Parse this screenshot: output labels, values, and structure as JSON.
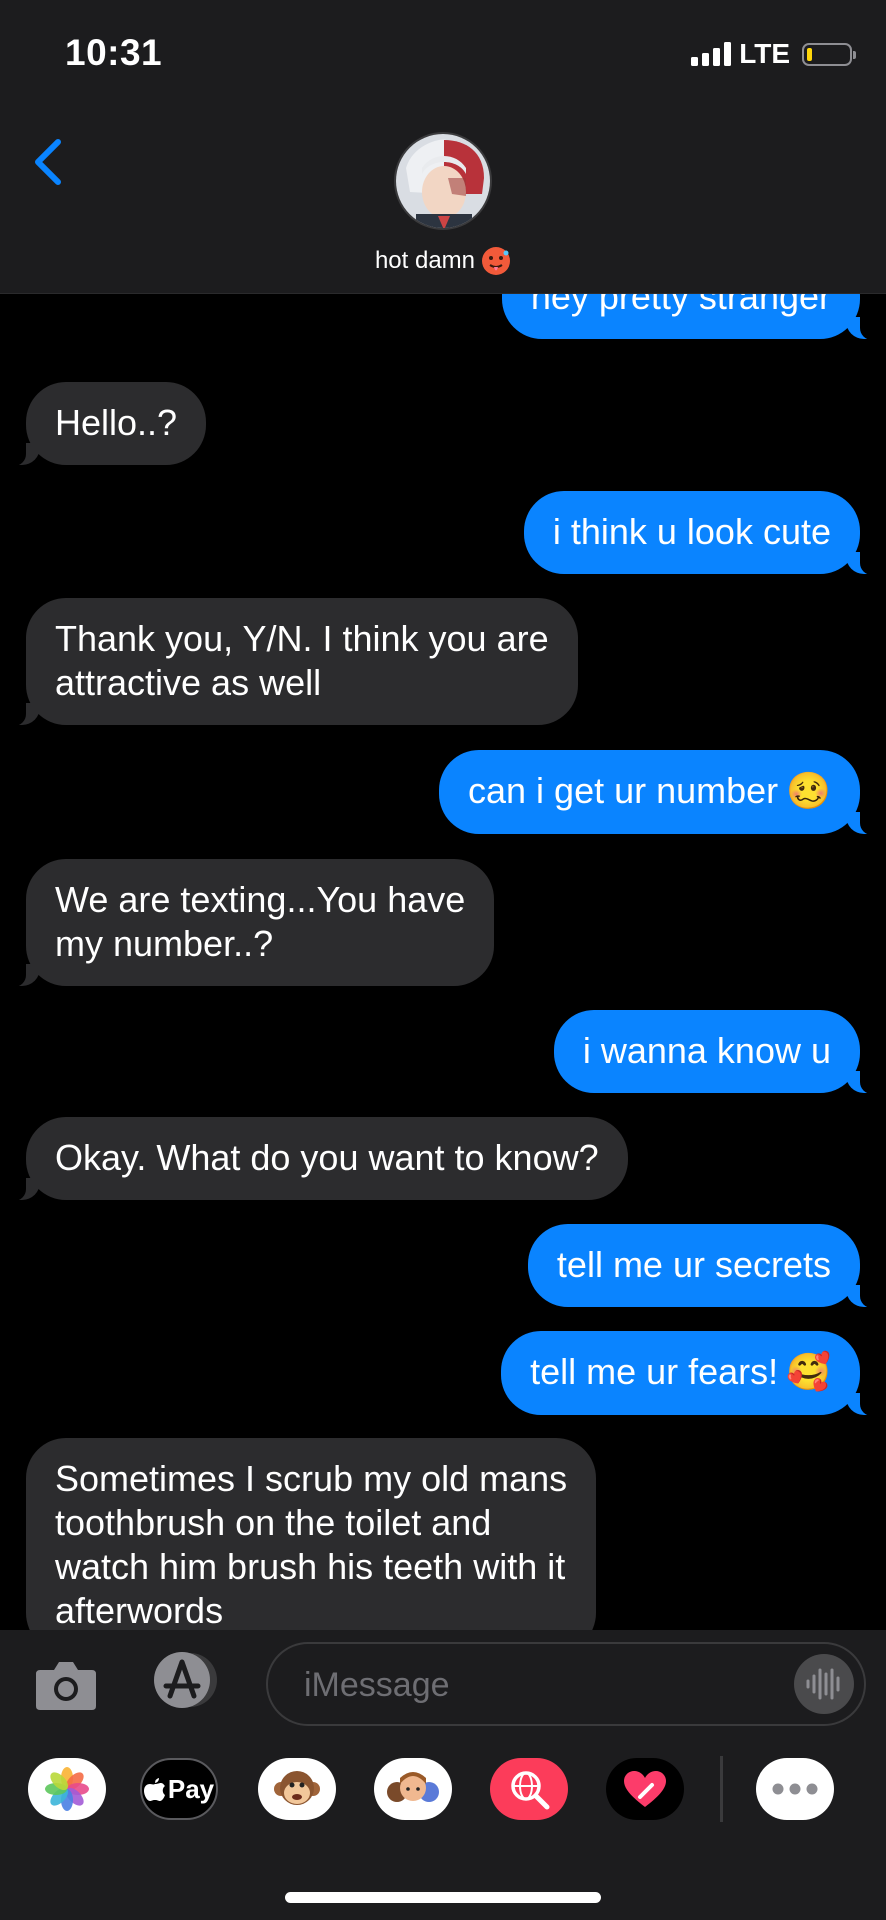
{
  "status_bar": {
    "time": "10:31",
    "network": "LTE",
    "battery_level": 0.12
  },
  "header": {
    "contact_name": "hot damn",
    "contact_emoji": "🥵",
    "back_icon": "chevron-left-icon",
    "accent_color": "#0a84ff"
  },
  "messages": [
    {
      "from": "me",
      "lines": [
        "hey pretty stranger"
      ]
    },
    {
      "from": "them",
      "lines": [
        "Hello..?"
      ]
    },
    {
      "from": "me",
      "lines": [
        "i think u look cute"
      ]
    },
    {
      "from": "them",
      "lines": [
        "Thank you, Y/N. I think you are",
        "attractive as well"
      ]
    },
    {
      "from": "me",
      "lines": [
        "can i get ur number"
      ],
      "emoji": "🥴"
    },
    {
      "from": "them",
      "lines": [
        "We are texting...You have",
        "my number..?"
      ]
    },
    {
      "from": "me",
      "lines": [
        "i wanna know u"
      ]
    },
    {
      "from": "them",
      "lines": [
        "Okay. What do you want to know?"
      ]
    },
    {
      "from": "me",
      "lines": [
        "tell me ur secrets"
      ]
    },
    {
      "from": "me",
      "lines": [
        "tell me ur fears!"
      ],
      "emoji": "🥰"
    },
    {
      "from": "them",
      "lines": [
        "Sometimes I scrub my old mans",
        "toothbrush on the toilet and",
        "watch him brush his teeth with it",
        "afterwords"
      ]
    }
  ],
  "input_bar": {
    "placeholder": "iMessage",
    "camera_icon": "camera-icon",
    "appstore_icon": "app-store-icon",
    "audio_icon": "audio-waveform-icon"
  },
  "app_drawer": {
    "apps": [
      {
        "name": "photos",
        "icon": "photos-icon"
      },
      {
        "name": "apple-pay",
        "label": "Pay",
        "icon": "apple-pay-icon"
      },
      {
        "name": "animoji",
        "icon": "monkey-animoji-icon"
      },
      {
        "name": "memoji",
        "icon": "memoji-stickers-icon"
      },
      {
        "name": "search-images",
        "icon": "globe-search-icon"
      },
      {
        "name": "digital-touch",
        "icon": "heart-touch-icon"
      },
      {
        "name": "more",
        "icon": "more-icon"
      }
    ]
  }
}
